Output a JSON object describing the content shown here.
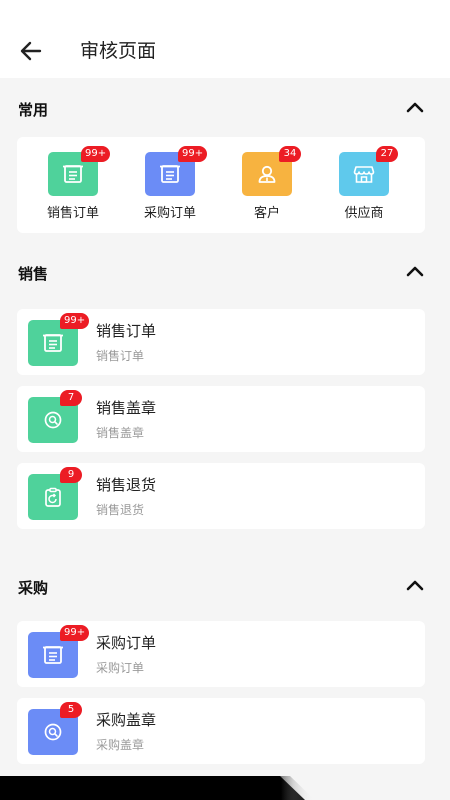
{
  "header": {
    "title": "审核页面"
  },
  "sections": {
    "common": {
      "title": "常用",
      "items": [
        {
          "label": "销售订单",
          "badge": "99+",
          "color": "#4fd29b",
          "icon": "order-icon"
        },
        {
          "label": "采购订单",
          "badge": "99+",
          "color": "#6b8cf6",
          "icon": "order-icon"
        },
        {
          "label": "客户",
          "badge": "34",
          "color": "#f7b340",
          "icon": "customer-icon"
        },
        {
          "label": "供应商",
          "badge": "27",
          "color": "#5fc9ec",
          "icon": "store-icon"
        }
      ]
    },
    "sales": {
      "title": "销售",
      "items": [
        {
          "title": "销售订单",
          "subtitle": "销售订单",
          "badge": "99+",
          "color": "#4fd29b",
          "icon": "order-icon"
        },
        {
          "title": "销售盖章",
          "subtitle": "销售盖章",
          "badge": "7",
          "color": "#4fd29b",
          "icon": "stamp-icon"
        },
        {
          "title": "销售退货",
          "subtitle": "销售退货",
          "badge": "9",
          "color": "#4fd29b",
          "icon": "return-icon"
        }
      ]
    },
    "purchase": {
      "title": "采购",
      "items": [
        {
          "title": "采购订单",
          "subtitle": "采购订单",
          "badge": "99+",
          "color": "#6b8cf6",
          "icon": "order-icon"
        },
        {
          "title": "采购盖章",
          "subtitle": "采购盖章",
          "badge": "5",
          "color": "#6b8cf6",
          "icon": "stamp-icon"
        }
      ]
    }
  }
}
